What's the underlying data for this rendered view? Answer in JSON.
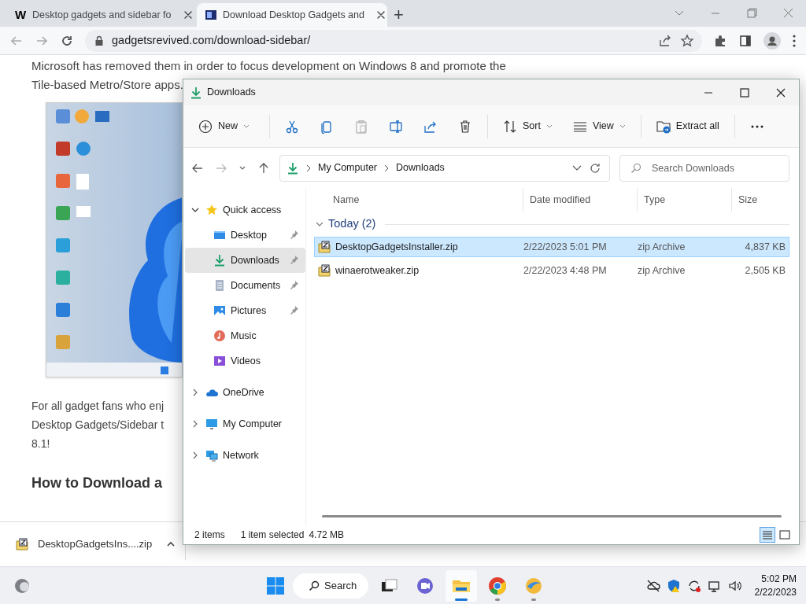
{
  "browser": {
    "tabs": [
      {
        "favicon": "W",
        "title": "Desktop gadgets and sidebar fo",
        "selected": false
      },
      {
        "title": "Download Desktop Gadgets and",
        "selected": true
      }
    ],
    "new_tab": "+",
    "url": "gadgetsrevived.com/download-sidebar/"
  },
  "article": {
    "intro": [
      "Microsoft has removed them in order to focus development on Windows 8 and promote the",
      "Tile-based Metro/Store apps."
    ],
    "paragraph_lines": [
      "For all gadget fans who enj",
      "Desktop Gadgets/Sidebar t",
      "8.1!"
    ],
    "heading": "How to Download a"
  },
  "explorer": {
    "title": "Downloads",
    "toolbar": [
      {
        "label": "New",
        "disabled": false
      },
      {
        "disabled": false
      },
      {
        "disabled": false
      },
      {
        "disabled": true
      },
      {
        "disabled": false
      },
      {
        "disabled": false
      },
      {
        "disabled": false
      },
      {
        "label": "Sort",
        "disabled": false
      },
      {
        "label": "View",
        "disabled": false
      },
      {
        "label": "Extract all",
        "disabled": false
      },
      {
        "disabled": false
      }
    ],
    "nav": {
      "back_disabled": false,
      "forward_disabled": true
    },
    "breadcrumb": [
      "My Computer",
      "Downloads"
    ],
    "search": {
      "placeholder": "Search Downloads"
    },
    "tree": [
      {
        "kind": "star",
        "label": "Quick access",
        "expanded": true,
        "selected": false,
        "children": [
          {
            "kind": "desktop",
            "label": "Desktop",
            "pinned": true,
            "selected": false
          },
          {
            "kind": "downloads",
            "label": "Downloads",
            "pinned": true,
            "selected": true
          },
          {
            "kind": "documents",
            "label": "Documents",
            "pinned": true,
            "selected": false
          },
          {
            "kind": "pictures",
            "label": "Pictures",
            "pinned": true,
            "selected": false
          },
          {
            "kind": "music",
            "label": "Music",
            "pinned": false,
            "selected": false
          },
          {
            "kind": "videos",
            "label": "Videos",
            "pinned": false,
            "selected": false
          }
        ]
      },
      {
        "kind": "cloud",
        "label": "OneDrive",
        "expanded": false,
        "selected": false
      },
      {
        "kind": "computer",
        "label": "My Computer",
        "expanded": false,
        "selected": false
      },
      {
        "kind": "network",
        "label": "Network",
        "expanded": false,
        "selected": false
      }
    ],
    "columns": [
      "Name",
      "Date modified",
      "Type",
      "Size"
    ],
    "groups": [
      {
        "label": "Today (2)",
        "expanded": true,
        "files": [
          {
            "name": "DesktopGadgetsInstaller.zip",
            "date": "2/22/2023 5:01 PM",
            "type": "zip Archive",
            "size": "4,837 KB",
            "selected": true
          },
          {
            "name": "winaerotweaker.zip",
            "date": "2/22/2023 4:48 PM",
            "type": "zip Archive",
            "size": "2,505 KB",
            "selected": false
          }
        ]
      }
    ],
    "status": [
      "2 items",
      "1 item selected",
      "4.72 MB"
    ],
    "view_buttons": [
      {
        "kind": "details",
        "selected": true
      },
      {
        "kind": "tiles",
        "selected": false
      }
    ]
  },
  "download_bar": {
    "file": "DesktopGadgetsIns....zip"
  },
  "taskbar": {
    "search": "Search",
    "apps": [
      {
        "kind": "taskview",
        "running": false,
        "active": false
      },
      {
        "kind": "chat",
        "running": false,
        "active": false
      },
      {
        "kind": "files",
        "running": true,
        "active": true
      },
      {
        "kind": "chrome",
        "running": true,
        "active": false
      },
      {
        "kind": "app",
        "running": true,
        "active": false
      }
    ],
    "time": "5:02 PM",
    "date": "2/22/2023"
  }
}
